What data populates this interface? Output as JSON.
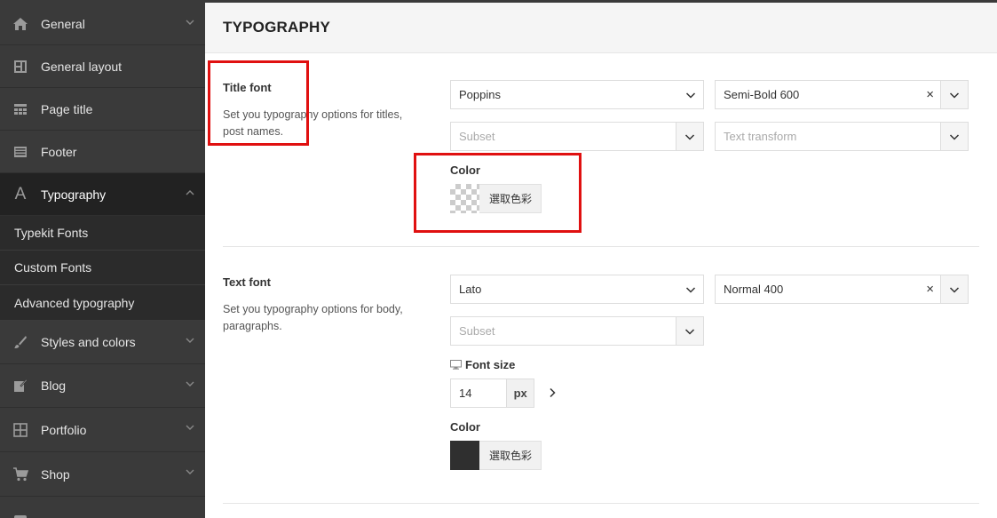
{
  "sidebar": {
    "items": [
      {
        "label": "General",
        "icon": "home-icon"
      },
      {
        "label": "General layout",
        "icon": "layout-icon"
      },
      {
        "label": "Page title",
        "icon": "page-title-icon"
      },
      {
        "label": "Footer",
        "icon": "footer-icon"
      },
      {
        "label": "Typography",
        "icon": "typography-icon"
      }
    ],
    "subitems": [
      "Typekit Fonts",
      "Custom Fonts",
      "Advanced typography"
    ],
    "items_after": [
      {
        "label": "Styles and colors",
        "icon": "brush-icon"
      },
      {
        "label": "Blog",
        "icon": "blog-icon"
      },
      {
        "label": "Portfolio",
        "icon": "portfolio-icon"
      },
      {
        "label": "Shop",
        "icon": "cart-icon"
      }
    ]
  },
  "header": {
    "title": "TYPOGRAPHY"
  },
  "title_font": {
    "label": "Title font",
    "description": "Set you typography options for titles, post names.",
    "family": "Poppins",
    "weight": "Semi-Bold 600",
    "subset_placeholder": "Subset",
    "transform_placeholder": "Text transform",
    "color_label": "Color",
    "color_button": "選取色彩"
  },
  "text_font": {
    "label": "Text font",
    "description": "Set you typography options for body, paragraphs.",
    "family": "Lato",
    "weight": "Normal 400",
    "subset_placeholder": "Subset",
    "font_size_label": "Font size",
    "font_size_value": "14",
    "font_size_unit": "px",
    "color_label": "Color",
    "color_button": "選取色彩",
    "color_value": "#2f2f2f"
  },
  "colors": {
    "sidebar_bg": "#3a3a3a",
    "active_bg": "#222222",
    "highlight": "#e01010"
  }
}
